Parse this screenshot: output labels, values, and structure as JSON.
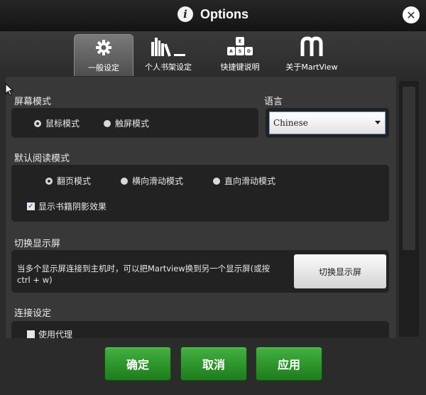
{
  "window": {
    "title": "Options",
    "close_glyph": "✕"
  },
  "tabs": [
    {
      "label": "一般设定",
      "icon": "gear-icon",
      "active": true
    },
    {
      "label": "个人书架设定",
      "icon": "bookshelf-icon",
      "active": false
    },
    {
      "label": "快捷键说明",
      "icon": "keyboard-icon",
      "active": false
    },
    {
      "label": "关于MartView",
      "icon": "martview-logo-icon",
      "active": false
    }
  ],
  "screen_mode": {
    "title": "屏幕模式",
    "options": [
      {
        "label": "鼠标模式",
        "selected": true
      },
      {
        "label": "触屏模式",
        "selected": false
      }
    ]
  },
  "language": {
    "title": "语言",
    "value": "Chinese"
  },
  "reading_mode": {
    "title": "默认阅读模式",
    "options": [
      {
        "label": "翻页模式",
        "selected": true
      },
      {
        "label": "横向滑动模式",
        "selected": false
      },
      {
        "label": "直向滑动模式",
        "selected": false
      }
    ],
    "shadow_checkbox": {
      "label": "显示书籍阴影效果",
      "checked": true
    }
  },
  "switch_display": {
    "title": "切换显示屏",
    "description": "当多个显示屏连接到主机时，可以把Martview换到另一个显示屏(或按ctrl + w)",
    "button_label": "切换显示屏"
  },
  "connection": {
    "title": "连接设定",
    "proxy_checkbox": {
      "label": "使用代理",
      "checked": false
    }
  },
  "footer": {
    "ok_label": "确定",
    "cancel_label": "取消",
    "apply_label": "应用"
  },
  "colors": {
    "accent_green": "#2e9a2c",
    "panel": "#222222",
    "background": "#383838"
  }
}
